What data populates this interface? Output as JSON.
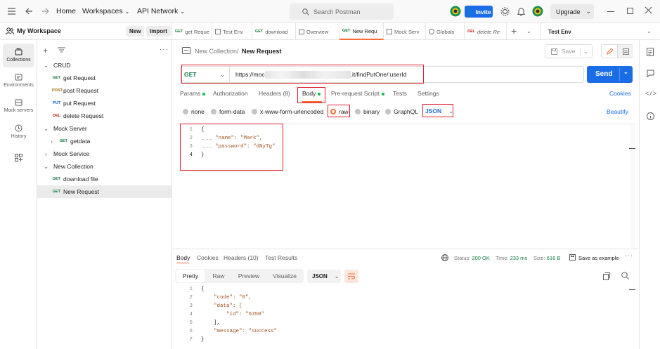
{
  "topbar": {
    "home": "Home",
    "workspaces": "Workspaces",
    "api_network": "API Network",
    "search_placeholder": "Search Postman",
    "invite": "Invite",
    "upgrade": "Upgrade"
  },
  "workspace": {
    "title": "My Workspace",
    "new": "New",
    "import": "Import"
  },
  "rail": [
    {
      "label": "Collections",
      "icon": "collections-icon"
    },
    {
      "label": "Environments",
      "icon": "environments-icon"
    },
    {
      "label": "Mock servers",
      "icon": "mock-servers-icon"
    },
    {
      "label": "History",
      "icon": "history-icon"
    }
  ],
  "tree": [
    {
      "type": "folder",
      "label": "CRUD",
      "expanded": true
    },
    {
      "type": "request",
      "method": "GET",
      "label": "get Request"
    },
    {
      "type": "request",
      "method": "POST",
      "label": "post Request"
    },
    {
      "type": "request",
      "method": "PUT",
      "label": "put Request"
    },
    {
      "type": "request",
      "method": "DEL",
      "label": "delete Request"
    },
    {
      "type": "folder",
      "label": "Mock Server",
      "expanded": true
    },
    {
      "type": "subfolder",
      "method": "GET",
      "label": "getdata"
    },
    {
      "type": "folder",
      "label": "Mock Service",
      "expanded": false
    },
    {
      "type": "folder",
      "label": "New Collection",
      "expanded": true
    },
    {
      "type": "request",
      "method": "GET",
      "label": "download file"
    },
    {
      "type": "request",
      "method": "GET",
      "label": "New Request",
      "selected": true
    }
  ],
  "tabs": [
    {
      "method": "GET",
      "label": "get Reque"
    },
    {
      "method": "",
      "label": "Test Env"
    },
    {
      "method": "GET",
      "label": "download"
    },
    {
      "method": "",
      "label": "Overview"
    },
    {
      "method": "GET",
      "label": "New Requ",
      "active": true
    },
    {
      "method": "",
      "label": "Mock Serv"
    },
    {
      "method": "",
      "label": "Globals"
    },
    {
      "method": "DEL",
      "label": "delete Re"
    }
  ],
  "environment": "Test Env",
  "request": {
    "breadcrumb_parent": "New Collection",
    "breadcrumb_sep": "/",
    "name": "New Request",
    "save": "Save",
    "method": "GET",
    "url_prefix": "https://moc",
    "url_suffix": ".it/findPutOne/:userId",
    "send": "Send",
    "subtabs": [
      "Params",
      "Authorization",
      "Headers (8)",
      "Body",
      "Pre-request Script",
      "Tests",
      "Settings"
    ],
    "cookies": "Cookies",
    "body_types": [
      "none",
      "form-data",
      "x-www-form-urlencoded",
      "raw",
      "binary",
      "GraphQL"
    ],
    "body_format": "JSON",
    "beautify": "Beautify",
    "body_lines": [
      "{",
      "\"name\": \"Mark\",",
      "\"password\": \"dNyTg\"",
      "}"
    ]
  },
  "response": {
    "tabs": [
      "Body",
      "Cookies",
      "Headers (10)",
      "Test Results"
    ],
    "status_label": "Status:",
    "status": "200 OK",
    "time_label": "Time:",
    "time": "233 ms",
    "size_label": "Size:",
    "size": "616 B",
    "save_example": "Save as example",
    "views": [
      "Pretty",
      "Raw",
      "Preview",
      "Visualize"
    ],
    "format": "JSON",
    "lines": [
      "{",
      "\"code\": \"0\",",
      "\"data\": [",
      "\"id\": \"6350\"",
      "],",
      "\"message\": \"success\"",
      "}"
    ]
  }
}
